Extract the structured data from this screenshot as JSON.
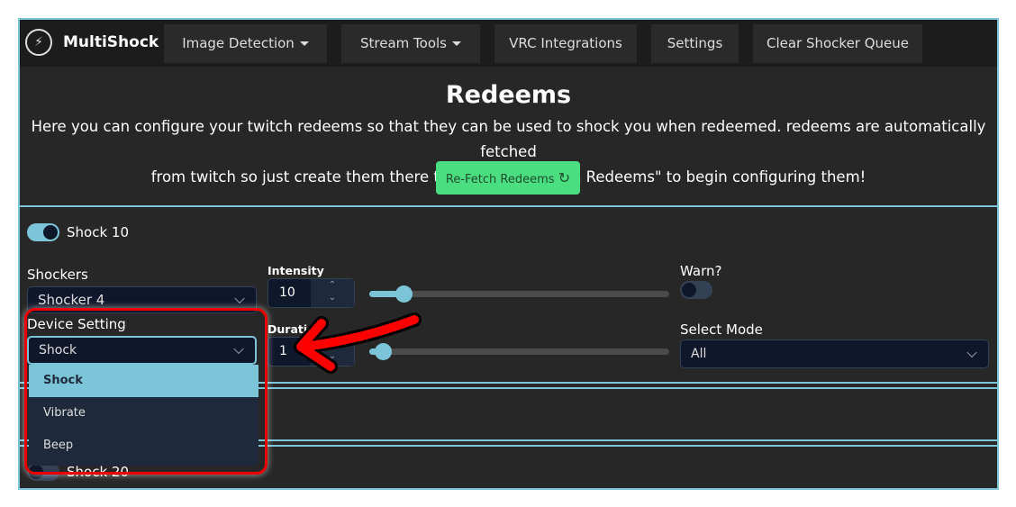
{
  "nav": {
    "brand": "MultiShock",
    "items": [
      "Image Detection",
      "Stream Tools",
      "VRC Integrations",
      "Settings",
      "Clear Shocker Queue"
    ]
  },
  "header": {
    "title": "Redeems",
    "description_line1": "Here you can configure your twitch redeems so that they can be used to shock you when redeemed. redeems are automatically fetched",
    "description_line2": "from twitch so just create them there then click \"Re-Fetch Redeems\" to begin configuring them!",
    "refetch_label": "Re-Fetch Redeems"
  },
  "redeem": {
    "name": "Shock 10",
    "enabled": true,
    "shockers_label": "Shockers",
    "shocker": "Shocker 4",
    "device_setting_label": "Device Setting",
    "device_setting": "Shock",
    "options": [
      "Shock",
      "Vibrate",
      "Beep"
    ],
    "intensity_label": "Intensity",
    "intensity": "10",
    "intensity_slider_percent": 10,
    "duration_label": "Duration",
    "duration": "1",
    "duration_slider_percent": 3,
    "warn_label": "Warn?",
    "warn": false,
    "select_mode_label": "Select Mode",
    "select_mode": "All"
  },
  "redeem2": {
    "name": "Shock 20",
    "enabled": false
  },
  "colors": {
    "accent": "#7cc4d8",
    "button_green": "#4ade80",
    "annotation": "#ff0000"
  }
}
